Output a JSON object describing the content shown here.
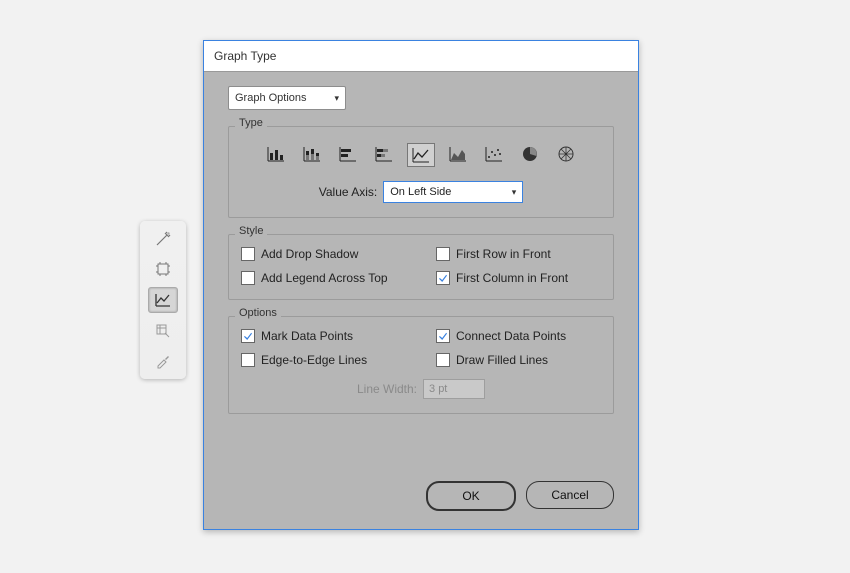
{
  "dialog": {
    "title": "Graph Type",
    "dropdown_label": "Graph Options",
    "type": {
      "legend": "Type",
      "value_axis_label": "Value Axis:",
      "value_axis_value": "On Left Side"
    },
    "style": {
      "legend": "Style",
      "add_drop_shadow": "Add Drop Shadow",
      "first_row_front": "First Row in Front",
      "add_legend_top": "Add Legend Across Top",
      "first_col_front": "First Column in Front"
    },
    "options": {
      "legend": "Options",
      "mark_points": "Mark Data Points",
      "connect_points": "Connect Data Points",
      "edge_lines": "Edge-to-Edge Lines",
      "filled_lines": "Draw Filled Lines",
      "line_width_label": "Line Width:",
      "line_width_value": "3 pt"
    },
    "buttons": {
      "ok": "OK",
      "cancel": "Cancel"
    }
  }
}
